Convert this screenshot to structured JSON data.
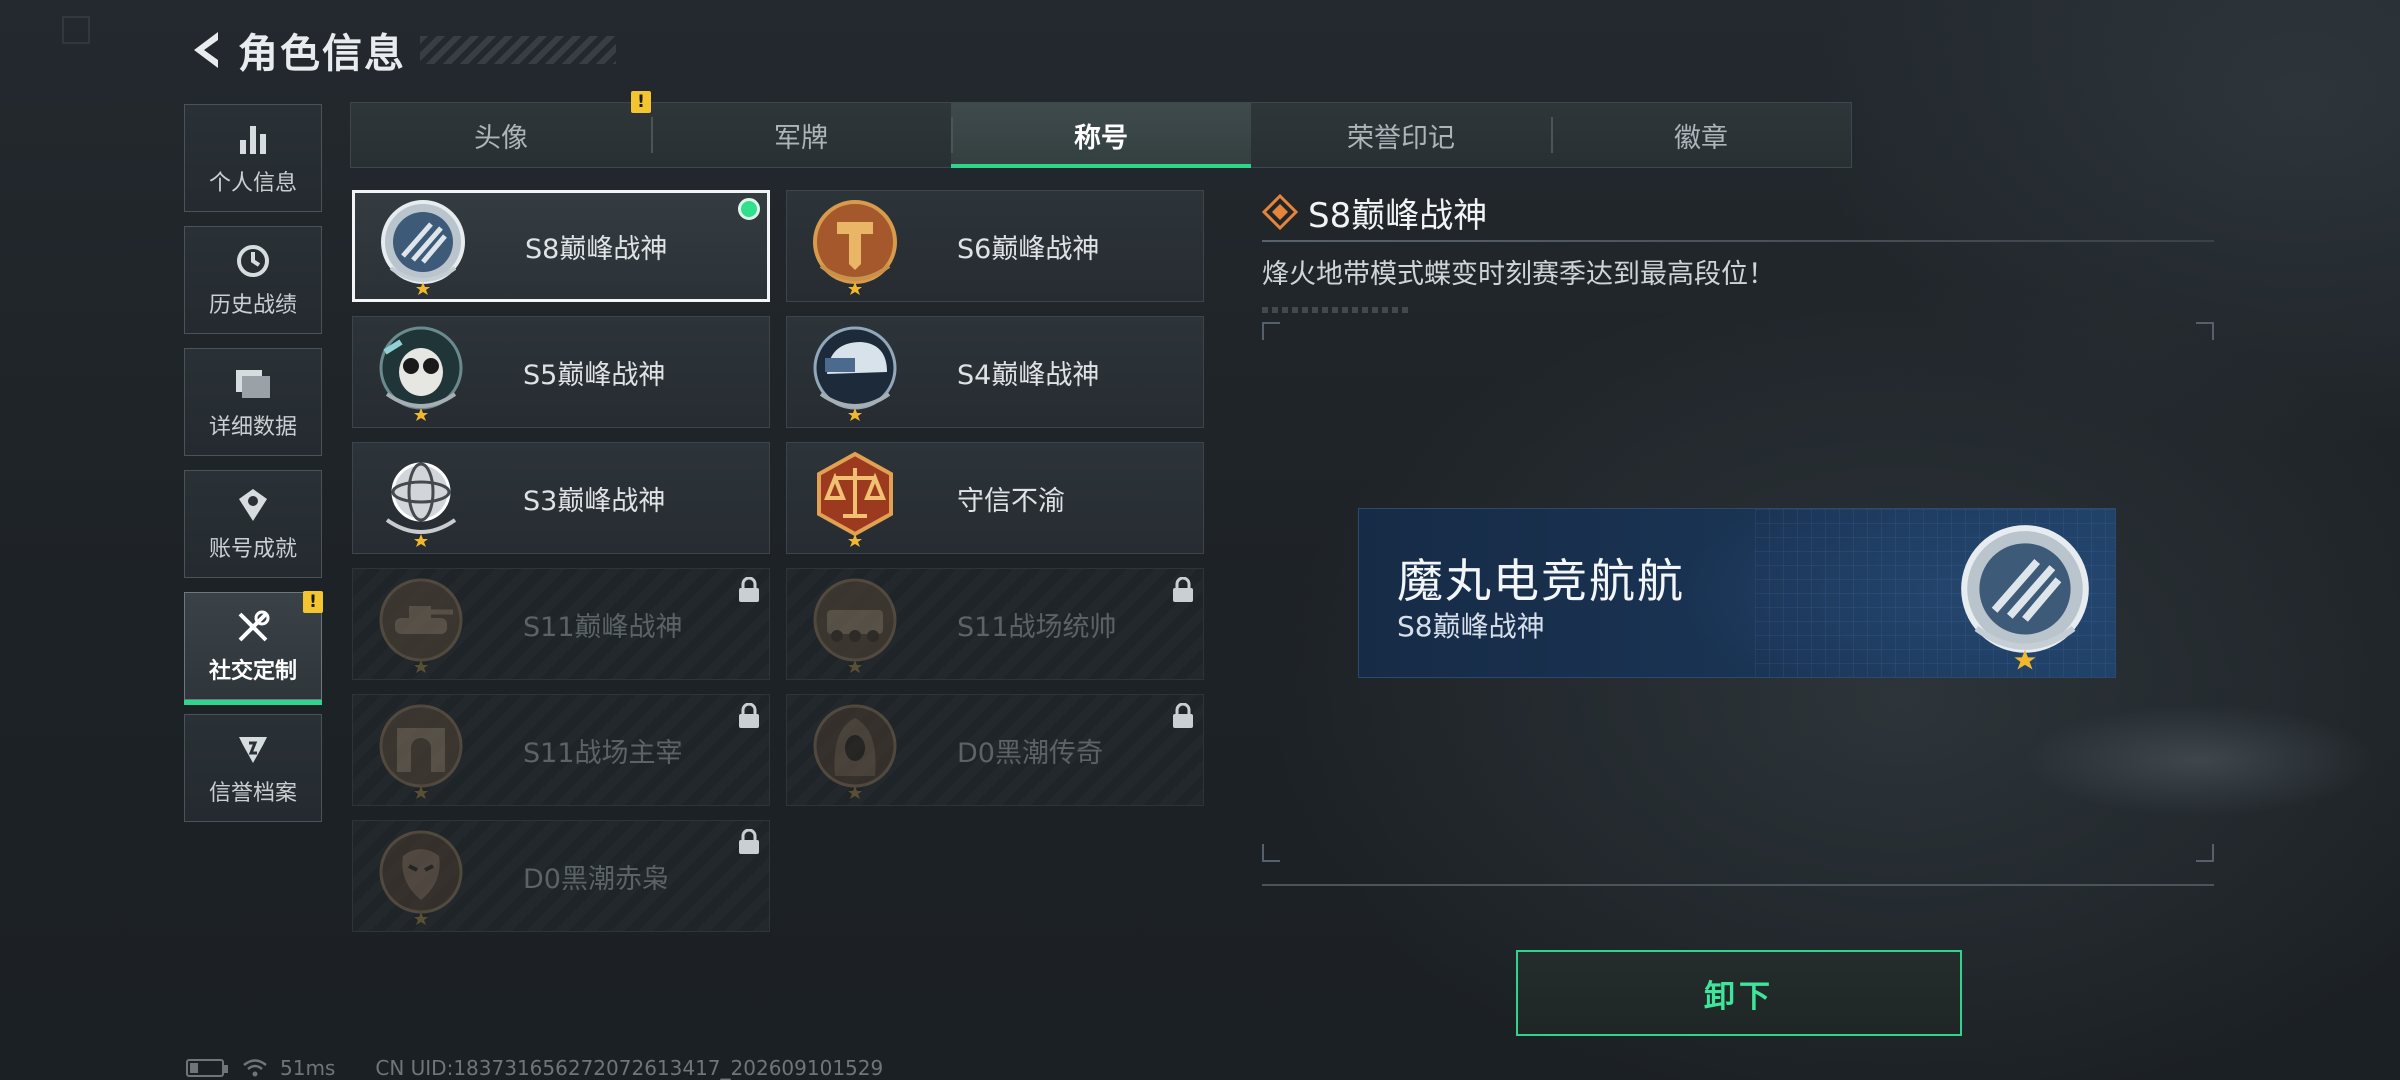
{
  "header": {
    "title": "角色信息"
  },
  "sidenav": {
    "items": [
      {
        "label": "个人信息",
        "icon": "bar-chart-icon",
        "active": false,
        "badge": ""
      },
      {
        "label": "历史战绩",
        "icon": "clock-icon",
        "active": false,
        "badge": ""
      },
      {
        "label": "详细数据",
        "icon": "folder-icon",
        "active": false,
        "badge": ""
      },
      {
        "label": "账号成就",
        "icon": "achievement-icon",
        "active": false,
        "badge": ""
      },
      {
        "label": "社交定制",
        "icon": "tools-icon",
        "active": true,
        "badge": "!"
      },
      {
        "label": "信誉档案",
        "icon": "credit-icon",
        "active": false,
        "badge": ""
      }
    ]
  },
  "tabs": [
    {
      "label": "头像",
      "active": false,
      "badge": "!"
    },
    {
      "label": "军牌",
      "active": false,
      "badge": ""
    },
    {
      "label": "称号",
      "active": true,
      "badge": ""
    },
    {
      "label": "荣誉印记",
      "active": false,
      "badge": ""
    },
    {
      "label": "徽章",
      "active": false,
      "badge": ""
    }
  ],
  "titles": [
    {
      "label": "S8巅峰战神",
      "state": "equipped",
      "emblem": "blue-slash-emblem"
    },
    {
      "label": "S6巅峰战神",
      "state": "unlocked",
      "emblem": "bronze-shield-emblem"
    },
    {
      "label": "S5巅峰战神",
      "state": "unlocked",
      "emblem": "skull-goggles-emblem"
    },
    {
      "label": "S4巅峰战神",
      "state": "unlocked",
      "emblem": "helmet-emblem"
    },
    {
      "label": "S3巅峰战神",
      "state": "unlocked",
      "emblem": "globe-emblem"
    },
    {
      "label": "守信不渝",
      "state": "unlocked",
      "emblem": "scales-emblem"
    },
    {
      "label": "S11巅峰战神",
      "state": "locked",
      "emblem": "tank-emblem"
    },
    {
      "label": "S11战场统帅",
      "state": "locked",
      "emblem": "apc-emblem"
    },
    {
      "label": "S11战场主宰",
      "state": "locked",
      "emblem": "arch-emblem"
    },
    {
      "label": "D0黑潮传奇",
      "state": "locked",
      "emblem": "hooded-emblem"
    },
    {
      "label": "D0黑潮赤枭",
      "state": "locked",
      "emblem": "mask-emblem"
    }
  ],
  "detail": {
    "title": "S8巅峰战神",
    "description": "烽火地带模式蝶变时刻赛季达到最高段位！"
  },
  "nameplate": {
    "player_name": "魔丸电竞航航",
    "title": "S8巅峰战神"
  },
  "actions": {
    "unequip_label": "卸下"
  },
  "status": {
    "ping": "51ms",
    "uid": "CN UID:18373165627207261341​7_202609101529"
  },
  "colors": {
    "accent": "#2fd58a",
    "warning": "#f2c531",
    "nameplate_bg": "#1b3556"
  }
}
